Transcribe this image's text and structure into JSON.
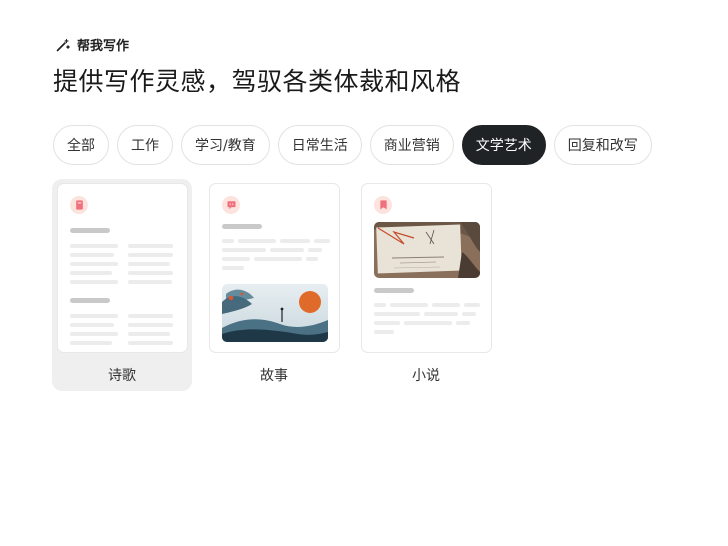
{
  "header": {
    "label": "帮我写作",
    "icon": "magic-wand-icon",
    "title": "提供写作灵感，驾驭各类体裁和风格"
  },
  "categories": [
    {
      "label": "全部",
      "active": false
    },
    {
      "label": "工作",
      "active": false
    },
    {
      "label": "学习/教育",
      "active": false
    },
    {
      "label": "日常生活",
      "active": false
    },
    {
      "label": "商业营销",
      "active": false
    },
    {
      "label": "文学艺术",
      "active": true
    },
    {
      "label": "回复和改写",
      "active": false
    }
  ],
  "templates": [
    {
      "label": "诗歌",
      "icon": "book-icon",
      "selected": true
    },
    {
      "label": "故事",
      "icon": "chat-bubble-icon",
      "selected": false
    },
    {
      "label": "小说",
      "icon": "bookmark-icon",
      "selected": false
    }
  ],
  "colors": {
    "accent_active_chip": "#1f2326",
    "badge_bg": "#fde3dd",
    "badge_icon": "#f0707e",
    "selected_card_bg": "#efefef"
  }
}
